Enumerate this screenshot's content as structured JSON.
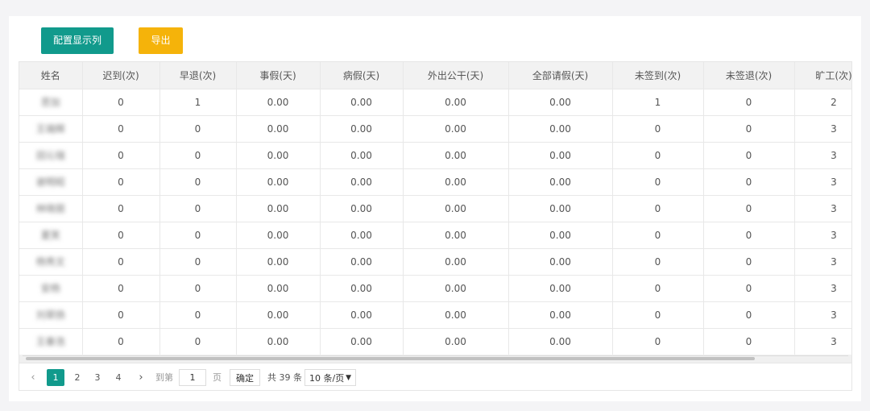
{
  "toolbar": {
    "config_columns_label": "配置显示列",
    "export_label": "导出"
  },
  "table": {
    "columns": [
      "姓名",
      "迟到(次)",
      "早退(次)",
      "事假(天)",
      "病假(天)",
      "外出公干(天)",
      "全部请假(天)",
      "未签到(次)",
      "未签退(次)",
      "旷工(次)"
    ],
    "rows": [
      [
        "思加",
        "0",
        "1",
        "0.00",
        "0.00",
        "0.00",
        "0.00",
        "1",
        "0",
        "2"
      ],
      [
        "王端辉",
        "0",
        "0",
        "0.00",
        "0.00",
        "0.00",
        "0.00",
        "0",
        "0",
        "3"
      ],
      [
        "田沁瑞",
        "0",
        "0",
        "0.00",
        "0.00",
        "0.00",
        "0.00",
        "0",
        "0",
        "3"
      ],
      [
        "谢明昭",
        "0",
        "0",
        "0.00",
        "0.00",
        "0.00",
        "0.00",
        "0",
        "0",
        "3"
      ],
      [
        "林晓丽",
        "0",
        "0",
        "0.00",
        "0.00",
        "0.00",
        "0.00",
        "0",
        "0",
        "3"
      ],
      [
        "夏笑",
        "0",
        "0",
        "0.00",
        "0.00",
        "0.00",
        "0.00",
        "0",
        "0",
        "3"
      ],
      [
        "杨秀文",
        "0",
        "0",
        "0.00",
        "0.00",
        "0.00",
        "0.00",
        "0",
        "0",
        "3"
      ],
      [
        "安杨",
        "0",
        "0",
        "0.00",
        "0.00",
        "0.00",
        "0.00",
        "0",
        "0",
        "3"
      ],
      [
        "刘翠扬",
        "0",
        "0",
        "0.00",
        "0.00",
        "0.00",
        "0.00",
        "0",
        "0",
        "3"
      ],
      [
        "王秦浩",
        "0",
        "0",
        "0.00",
        "0.00",
        "0.00",
        "0.00",
        "0",
        "0",
        "3"
      ]
    ]
  },
  "pagination": {
    "prev_icon": "chevron-left-icon",
    "next_icon": "chevron-right-icon",
    "pages": [
      "1",
      "2",
      "3",
      "4"
    ],
    "current_page": "1",
    "goto_label": "到第",
    "goto_value": "1",
    "page_unit": "页",
    "confirm_label": "确定",
    "total_text": "共 39 条",
    "page_size_label": "10 条/页"
  },
  "colors": {
    "primary": "#119a8c",
    "export": "#f5b30a"
  },
  "scroll": {
    "horizontal_position_fraction": 0.0
  }
}
